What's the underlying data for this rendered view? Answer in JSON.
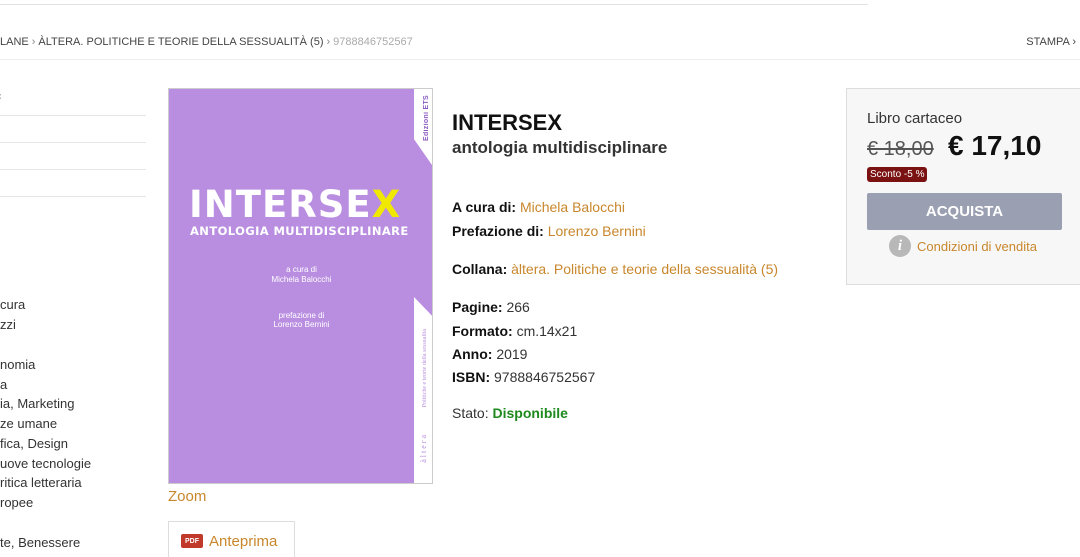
{
  "breadcrumb": {
    "items": [
      "LANE",
      "ÀLTERA. POLITICHE E TEORIE DELLA SESSUALITÀ (5)"
    ],
    "separator": "›",
    "current": "9788846752567",
    "print_label": "STAMPA"
  },
  "sidebar": {
    "mark": "‹",
    "categories": [
      "cura",
      "zzi",
      "nomia",
      "a",
      "ia, Marketing",
      "ze umane",
      "fica, Design",
      "uove tecnologie",
      "ritica letteraria",
      "ropee",
      "te, Benessere"
    ]
  },
  "cover": {
    "publisher": "Edizioni ETS",
    "title_main": "INTERSE",
    "title_x": "X",
    "subtitle": "ANTOLOGIA MULTIDISCIPLINARE",
    "editor_line1": "a cura di",
    "editor_line2": "Michela Balocchi",
    "preface_line1": "prefazione di",
    "preface_line2": "Lorenzo Bernini",
    "spine_series": "Politiche e teorie della sessualità",
    "spine_brand": "àltera"
  },
  "media": {
    "zoom_label": "Zoom",
    "preview_label": "Anteprima",
    "pdf_badge": "PDF"
  },
  "book": {
    "title": "INTERSEX",
    "subtitle": "antologia multidisciplinare",
    "editor_label": "A cura di:",
    "editor": "Michela Balocchi",
    "preface_label": "Prefazione di:",
    "preface": "Lorenzo Bernini",
    "series_label": "Collana:",
    "series": "àltera. Politiche e teorie della sessualità (5)",
    "pages_label": "Pagine:",
    "pages": "266",
    "format_label": "Formato:",
    "format": "cm.14x21",
    "year_label": "Anno:",
    "year": "2019",
    "isbn_label": "ISBN:",
    "isbn": "9788846752567",
    "status_label": "Stato:",
    "status": "Disponibile"
  },
  "buybox": {
    "type": "Libro cartaceo",
    "old_price": "€ 18,00",
    "new_price": "€ 17,10",
    "discount": "Sconto -5 %",
    "buy_label": "ACQUISTA",
    "conditions_label": "Condizioni di vendita"
  },
  "colors": {
    "link": "#c8872c",
    "cover": "#b98ee0",
    "available": "#1e8a1e",
    "discount_badge": "#7a1212",
    "buy_button": "#9aa0b2"
  }
}
